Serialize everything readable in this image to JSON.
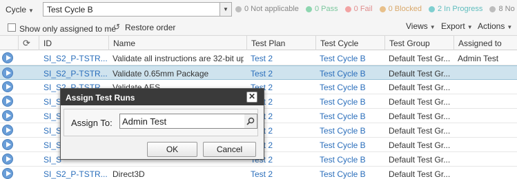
{
  "toolbar": {
    "cycle_label": "Cycle",
    "cycle_value": "Test Cycle B",
    "statuses": [
      {
        "label": "0 Not applicable",
        "color": "#bdbdbd"
      },
      {
        "label": "0 Pass",
        "color": "#8ed6b0"
      },
      {
        "label": "0 Fail",
        "color": "#f2a3a3"
      },
      {
        "label": "0 Blocked",
        "color": "#e8c08a"
      },
      {
        "label": "2 In Progress",
        "color": "#7fcfd0"
      },
      {
        "label": "8 No",
        "color": "#bdbdbd"
      }
    ],
    "show_assigned_label": "Show only assigned to me",
    "restore_order_label": "Restore order",
    "views_label": "Views",
    "export_label": "Export",
    "actions_label": "Actions"
  },
  "grid": {
    "headers": [
      "ID",
      "Name",
      "Test Plan",
      "Test Cycle",
      "Test Group",
      "Assigned to"
    ],
    "rows": [
      {
        "id": "SI_S2_P-TSTR...",
        "name": "Validate all instructions are 32-bit up...",
        "plan": "Test 2",
        "cycle": "Test Cycle B",
        "group": "Default Test Gr...",
        "assigned": "Admin Test"
      },
      {
        "id": "SI_S2_P-TSTR...",
        "name": "Validate 0.65mm Package",
        "plan": "Test 2",
        "cycle": "Test Cycle B",
        "group": "Default Test Gr...",
        "assigned": ""
      },
      {
        "id": "SI_S2_P-TSTR",
        "name": "Validate AES",
        "plan": "Test 2",
        "cycle": "Test Cycle B",
        "group": "Default Test Gr...",
        "assigned": ""
      },
      {
        "id": "SI_S",
        "name": "",
        "plan": "Test 2",
        "cycle": "Test Cycle B",
        "group": "Default Test Gr...",
        "assigned": ""
      },
      {
        "id": "SI_S",
        "name": "",
        "plan": "Test 2",
        "cycle": "Test Cycle B",
        "group": "Default Test Gr...",
        "assigned": ""
      },
      {
        "id": "SI_S",
        "name": "",
        "plan": "Test 2",
        "cycle": "Test Cycle B",
        "group": "Default Test Gr...",
        "assigned": ""
      },
      {
        "id": "SI_S",
        "name": "",
        "plan": "Test 2",
        "cycle": "Test Cycle B",
        "group": "Default Test Gr...",
        "assigned": ""
      },
      {
        "id": "SI_S",
        "name": "",
        "plan": "Test 2",
        "cycle": "Test Cycle B",
        "group": "Default Test Gr...",
        "assigned": ""
      },
      {
        "id": "SI_S2_P-TSTR...",
        "name": "Direct3D",
        "plan": "Test 2",
        "cycle": "Test Cycle B",
        "group": "Default Test Gr...",
        "assigned": ""
      }
    ]
  },
  "modal": {
    "title": "Assign Test Runs",
    "close_symbol": "✕",
    "assign_label": "Assign To:",
    "assign_value": "Admin Test",
    "ok_label": "OK",
    "cancel_label": "Cancel"
  }
}
